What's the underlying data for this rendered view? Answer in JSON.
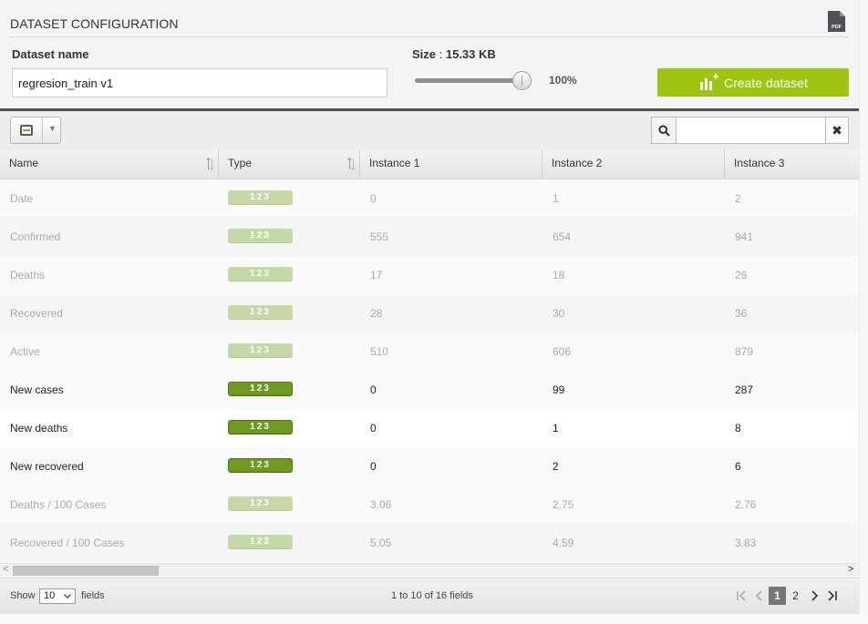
{
  "config": {
    "title": "DATASET CONFIGURATION",
    "pdf_icon": "pdf-file-icon",
    "dataset_name_label": "Dataset name",
    "dataset_name_value": "regresion_train v1",
    "size_label": "Size",
    "size_separator": " : ",
    "size_value": "15.33 KB",
    "sample_percent": "100%",
    "sample_fraction": 1.0,
    "create_button_label": "Create dataset",
    "create_button_icon": "chart-plus-icon",
    "accent_color": "#9dc512"
  },
  "toolbar": {
    "column_toggle_icon": "column-toggle-icon",
    "search_icon": "search-icon",
    "search_value": "",
    "clear_icon": "close-icon",
    "clear_glyph": "✖"
  },
  "table": {
    "headers": [
      "Name",
      "Type",
      "Instance 1",
      "Instance 2",
      "Instance 3"
    ],
    "type_badge_label": "123",
    "rows": [
      {
        "name": "Date",
        "i1": "0",
        "i2": "1",
        "i3": "2",
        "selected": false
      },
      {
        "name": "Confirmed",
        "i1": "555",
        "i2": "654",
        "i3": "941",
        "selected": false
      },
      {
        "name": "Deaths",
        "i1": "17",
        "i2": "18",
        "i3": "26",
        "selected": false
      },
      {
        "name": "Recovered",
        "i1": "28",
        "i2": "30",
        "i3": "36",
        "selected": false
      },
      {
        "name": "Active",
        "i1": "510",
        "i2": "606",
        "i3": "879",
        "selected": false
      },
      {
        "name": "New cases",
        "i1": "0",
        "i2": "99",
        "i3": "287",
        "selected": true
      },
      {
        "name": "New deaths",
        "i1": "0",
        "i2": "1",
        "i3": "8",
        "selected": true
      },
      {
        "name": "New recovered",
        "i1": "0",
        "i2": "2",
        "i3": "6",
        "selected": true
      },
      {
        "name": "Deaths / 100 Cases",
        "i1": "3.06",
        "i2": "2.75",
        "i3": "2.76",
        "selected": false
      },
      {
        "name": "Recovered / 100 Cases",
        "i1": "5.05",
        "i2": "4.59",
        "i3": "3.83",
        "selected": false
      }
    ]
  },
  "footer": {
    "show_label": "Show",
    "page_size": "10",
    "fields_label": "fields",
    "info": "1 to 10 of 16 fields",
    "pages": [
      "1",
      "2"
    ],
    "current_page": "1",
    "first_glyph": "|‹",
    "prev_glyph": "‹",
    "next_glyph": "›",
    "last_glyph": "›|"
  },
  "scrollbar": {
    "left_glyph": "<",
    "right_glyph": ">"
  }
}
